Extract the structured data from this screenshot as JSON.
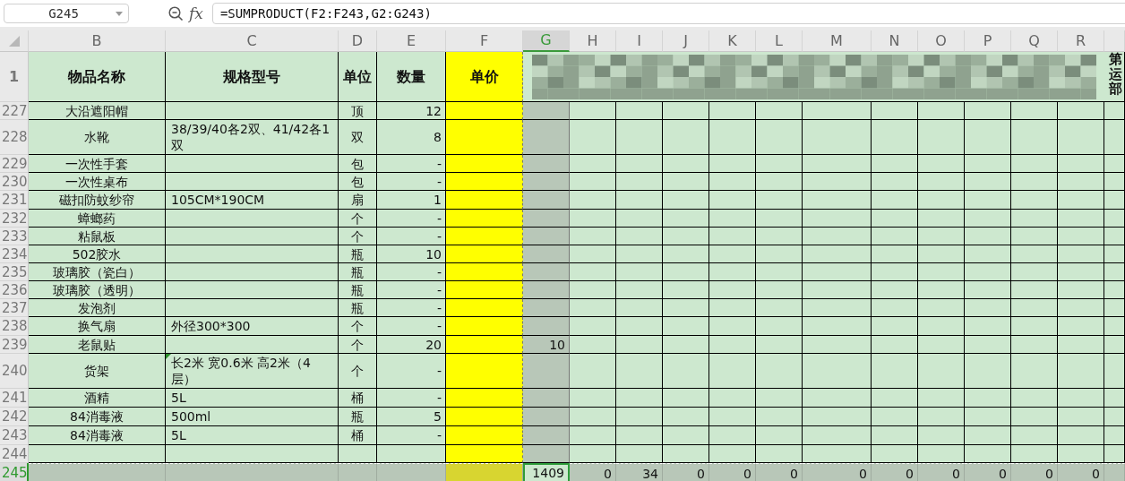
{
  "name_box": {
    "value": "G245"
  },
  "formula_bar": {
    "fx_label": "fx",
    "formula": "=SUMPRODUCT(F2:F243,G2:G243)"
  },
  "columns": [
    {
      "label": "B",
      "selected": false
    },
    {
      "label": "C",
      "selected": false
    },
    {
      "label": "D",
      "selected": false
    },
    {
      "label": "E",
      "selected": false
    },
    {
      "label": "F",
      "selected": false
    },
    {
      "label": "G",
      "selected": true
    },
    {
      "label": "H",
      "selected": false
    },
    {
      "label": "I",
      "selected": false
    },
    {
      "label": "J",
      "selected": false
    },
    {
      "label": "K",
      "selected": false
    },
    {
      "label": "L",
      "selected": false
    },
    {
      "label": "M",
      "selected": false
    },
    {
      "label": "N",
      "selected": false
    },
    {
      "label": "O",
      "selected": false
    },
    {
      "label": "P",
      "selected": false
    },
    {
      "label": "Q",
      "selected": false
    },
    {
      "label": "R",
      "selected": false
    }
  ],
  "header_row": {
    "row": "1",
    "cells": [
      "物品名称",
      "规格型号",
      "单位",
      "数量",
      "单价"
    ],
    "column_s": "第运部"
  },
  "rows": [
    {
      "row": "227",
      "name": "大沿遮阳帽",
      "unit": "顶",
      "qty": "12"
    },
    {
      "row": "228",
      "name": "水靴",
      "spec": "38/39/40各2双、41/42各1双",
      "unit": "双",
      "qty": "8"
    },
    {
      "row": "229",
      "name": "一次性手套",
      "unit": "包",
      "qty": "-"
    },
    {
      "row": "230",
      "name": "一次性桌布",
      "unit": "包",
      "qty": "-"
    },
    {
      "row": "231",
      "name": "磁扣防蚊纱帘",
      "spec": "105CM*190CM",
      "unit": "扇",
      "qty": "1"
    },
    {
      "row": "232",
      "name": "蟑螂药",
      "unit": "个",
      "qty": "-"
    },
    {
      "row": "233",
      "name": "粘鼠板",
      "unit": "个",
      "qty": "-"
    },
    {
      "row": "234",
      "name": "502胶水",
      "unit": "瓶",
      "qty": "10"
    },
    {
      "row": "235",
      "name": "玻璃胶（瓷白）",
      "unit": "瓶",
      "qty": "-"
    },
    {
      "row": "236",
      "name": "玻璃胶（透明）",
      "unit": "瓶",
      "qty": "-"
    },
    {
      "row": "237",
      "name": "发泡剂",
      "unit": "瓶",
      "qty": "-"
    },
    {
      "row": "238",
      "name": "换气扇",
      "spec": "外径300*300",
      "unit": "个",
      "qty": "-"
    },
    {
      "row": "239",
      "name": "老鼠贴",
      "unit": "个",
      "qty": "20",
      "g": "10"
    },
    {
      "row": "240",
      "name": "货架",
      "spec": "长2米 宽0.6米 高2米（4层）",
      "flagged": true,
      "unit": "个",
      "qty": "-"
    },
    {
      "row": "241",
      "name": "酒精",
      "spec": "5L",
      "unit": "桶",
      "qty": "-"
    },
    {
      "row": "242",
      "name": "84消毒液",
      "spec": "500ml",
      "unit": "瓶",
      "qty": "5"
    },
    {
      "row": "243",
      "name": "84消毒液",
      "spec": "5L",
      "unit": "桶",
      "qty": "-"
    },
    {
      "row": "244"
    }
  ],
  "total_row": {
    "row": "245",
    "selected": true,
    "values": [
      {
        "text": "1409",
        "selected": true
      },
      {
        "text": "0",
        "selected": false
      },
      {
        "text": "34",
        "selected": false
      },
      {
        "text": "0",
        "selected": false
      },
      {
        "text": "0",
        "selected": false
      },
      {
        "text": "0",
        "selected": false
      },
      {
        "text": "0",
        "selected": false
      },
      {
        "text": "0",
        "selected": false
      },
      {
        "text": "0",
        "selected": false
      },
      {
        "text": "0",
        "selected": false
      },
      {
        "text": "0",
        "selected": false
      },
      {
        "text": "0",
        "selected": false
      }
    ]
  }
}
